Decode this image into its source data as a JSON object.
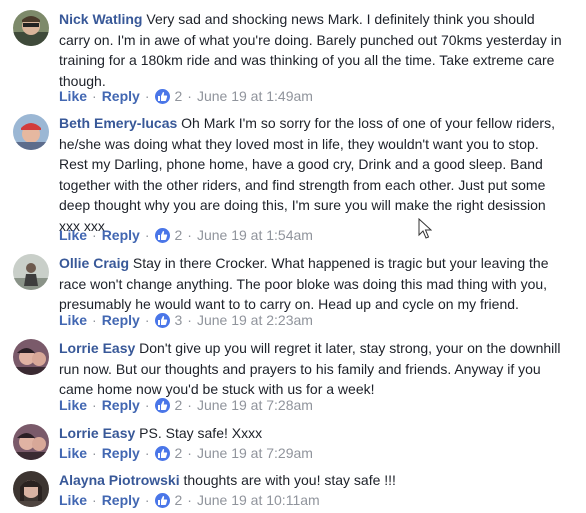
{
  "comments": [
    {
      "author": "Nick Watling",
      "text": "Very sad and shocking news Mark. I definitely think you should carry on. I'm in awe of what you're doing. Barely punched out 70kms yesterday in training for a 180km ride and was thinking of you all the time. Take extreme care though.",
      "like_label": "Like",
      "reply_label": "Reply",
      "likes": "2",
      "time": "June 19 at 1:49am",
      "avatar_color": "#5a6b4e"
    },
    {
      "author": "Beth Emery-lucas",
      "text": "Oh Mark I'm so sorry for the loss of one of your fellow riders, he/she was doing what they loved most in life, they wouldn't want you to stop. Rest my Darling, phone home, have a good cry, Drink and a good sleep. Band together with the other riders, and find strength from each other. Just put some deep thought why you are doing this, I'm sure you will make the right desission xxx xxx",
      "like_label": "Like",
      "reply_label": "Reply",
      "likes": "2",
      "time": "June 19 at 1:54am",
      "avatar_color": "#b84a4a"
    },
    {
      "author": "Ollie Craig",
      "text": "Stay in there Crocker. What happened is tragic but your leaving the race won't change anything. The poor bloke was doing this mad thing with you, presumably he would want to to carry on. Head up and cycle on my friend.",
      "like_label": "Like",
      "reply_label": "Reply",
      "likes": "3",
      "time": "June 19 at 2:23am",
      "avatar_color": "#9aa7a6"
    },
    {
      "author": "Lorrie Easy",
      "text": "Don't give up you will regret it later, stay strong, your on the downhill run now. But our thoughts and prayers to his family and friends. Anyway if you came home now you'd be stuck with us for a week!",
      "like_label": "Like",
      "reply_label": "Reply",
      "likes": "2",
      "time": "June 19 at 7:28am",
      "avatar_color": "#6b4a5e"
    },
    {
      "author": "Lorrie Easy",
      "text": "PS. Stay safe! Xxxx",
      "like_label": "Like",
      "reply_label": "Reply",
      "likes": "2",
      "time": "June 19 at 7:29am",
      "avatar_color": "#6b4a5e"
    },
    {
      "author": "Alayna Piotrowski",
      "text": "thoughts are with you! stay safe !!!",
      "like_label": "Like",
      "reply_label": "Reply",
      "likes": "2",
      "time": "June 19 at 10:11am",
      "avatar_color": "#4f4540"
    }
  ],
  "icons": {
    "like_badge": "thumbs-up-icon",
    "cursor": "mouse-cursor-icon"
  },
  "colors": {
    "author": "#385898",
    "action": "#4267b2",
    "meta": "#90949c",
    "like_badge": "#4a76e8"
  }
}
